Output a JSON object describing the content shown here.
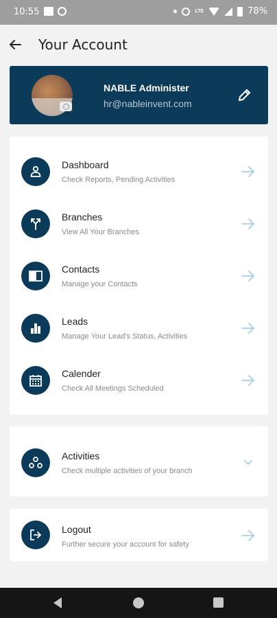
{
  "status_bar": {
    "time": "10:55",
    "battery": "78%",
    "network": "LTE"
  },
  "header": {
    "title": "Your Account"
  },
  "profile": {
    "name": "NABLE Administer",
    "email": "hr@nableinvent.com"
  },
  "menu": [
    {
      "title": "Dashboard",
      "subtitle": "Check Reports, Pending Activities",
      "icon": "person-icon"
    },
    {
      "title": "Branches",
      "subtitle": "View All Your Branches",
      "icon": "branch-icon"
    },
    {
      "title": "Contacts",
      "subtitle": "Manage your Contacts",
      "icon": "book-icon"
    },
    {
      "title": "Leads",
      "subtitle": "Manage Your Lead's Status, Activities",
      "icon": "bar-chart-icon"
    },
    {
      "title": "Calender",
      "subtitle": "Check All Meetings Scheduled",
      "icon": "calendar-icon"
    }
  ],
  "activities": {
    "title": "Activities",
    "subtitle": "Check multiple activities of your branch"
  },
  "logout": {
    "title": "Logout",
    "subtitle": "Further secure your account for safety"
  },
  "colors": {
    "primary": "#0c3a59",
    "arrow": "#a9cfe4",
    "background": "#f2f2f2"
  }
}
